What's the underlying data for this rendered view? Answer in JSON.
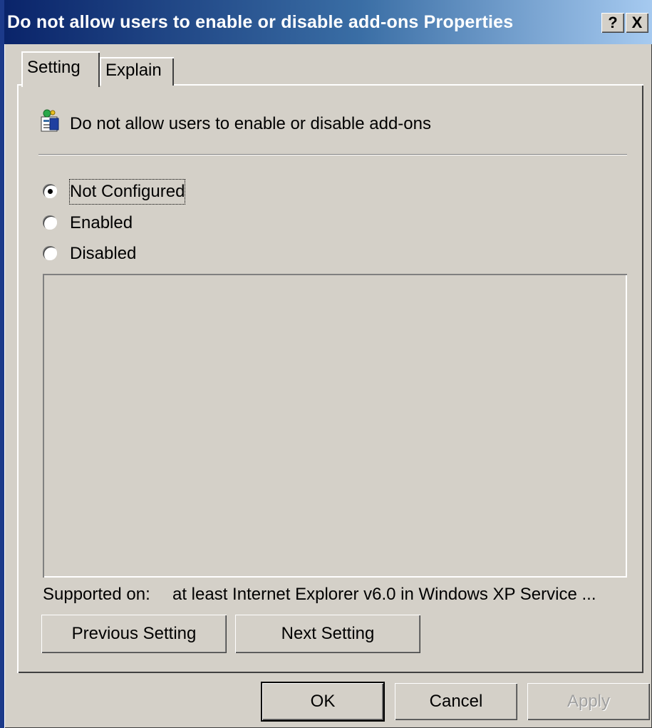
{
  "window": {
    "title": "Do not allow users to enable or disable add-ons Properties",
    "help_button": "?",
    "close_button": "X"
  },
  "tabs": [
    {
      "label": "Setting",
      "selected": true
    },
    {
      "label": "Explain",
      "selected": false
    }
  ],
  "policy": {
    "icon": "policy-setting-icon",
    "name": "Do not allow users to enable or disable add-ons"
  },
  "options": [
    {
      "label": "Not Configured",
      "checked": true,
      "focused": true
    },
    {
      "label": "Enabled",
      "checked": false
    },
    {
      "label": "Disabled",
      "checked": false
    }
  ],
  "supported": {
    "label": "Supported on:",
    "value": "at least Internet Explorer v6.0 in Windows XP Service ..."
  },
  "nav_buttons": {
    "previous": "Previous Setting",
    "next": "Next Setting"
  },
  "dialog_buttons": {
    "ok": "OK",
    "cancel": "Cancel",
    "apply": "Apply",
    "apply_disabled": true
  },
  "colors": {
    "face": "#d4d0c8",
    "title_start": "#0a246a",
    "title_end": "#a6caf0"
  }
}
